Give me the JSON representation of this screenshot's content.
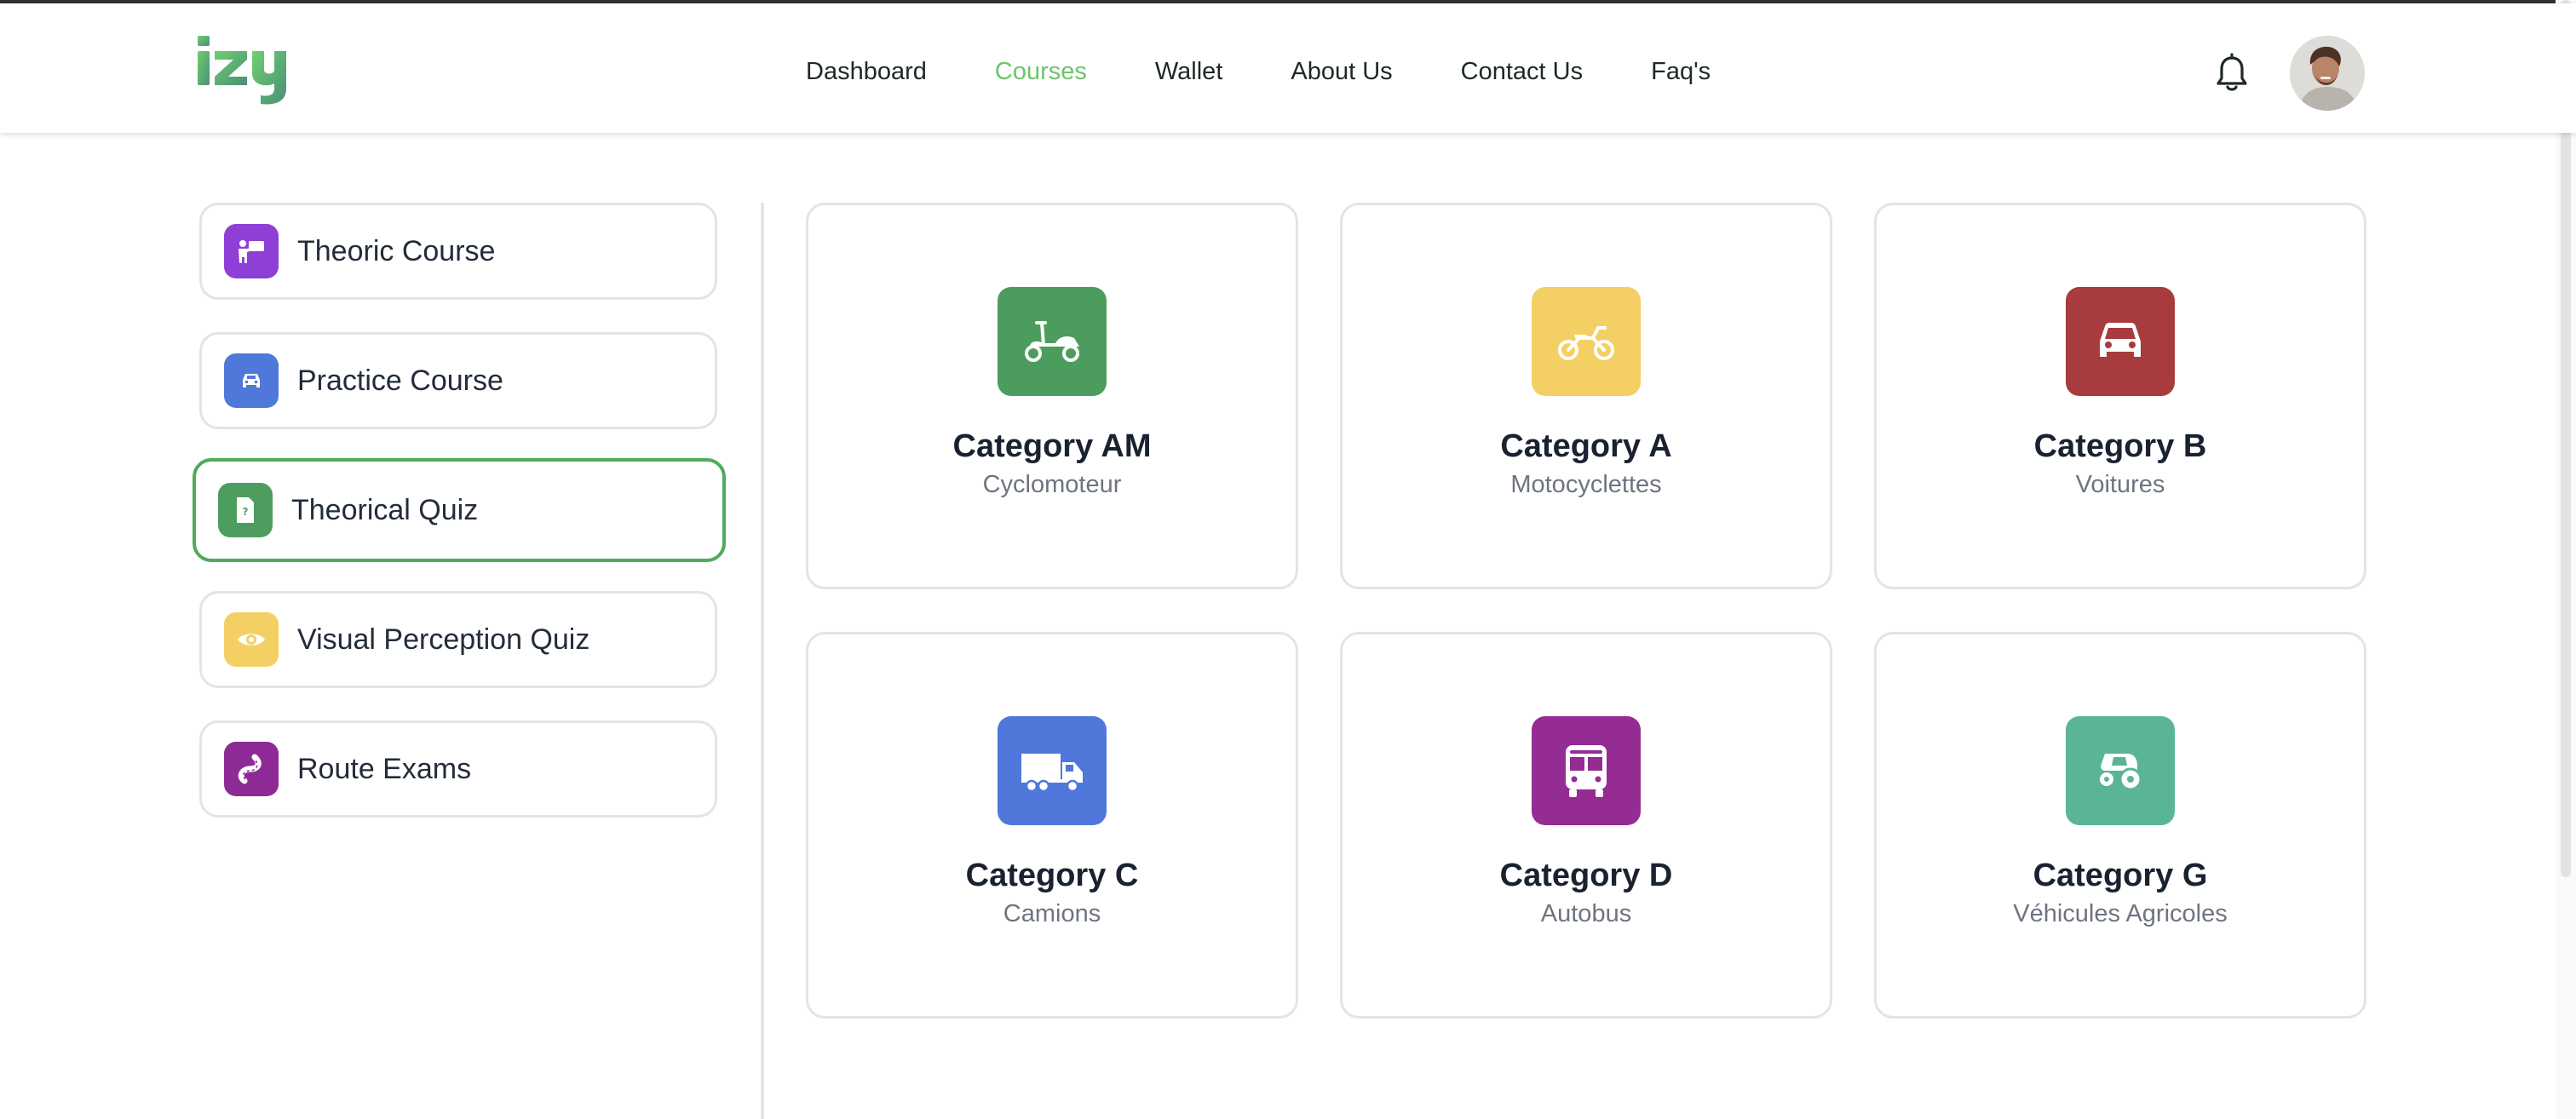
{
  "header": {
    "logo_text": "izy",
    "nav": [
      {
        "label": "Dashboard",
        "active": false
      },
      {
        "label": "Courses",
        "active": true
      },
      {
        "label": "Wallet",
        "active": false
      },
      {
        "label": "About Us",
        "active": false
      },
      {
        "label": "Contact Us",
        "active": false
      },
      {
        "label": "Faq's",
        "active": false
      }
    ],
    "icons": {
      "notifications": "bell-icon",
      "profile": "user-avatar"
    }
  },
  "sidebar": {
    "items": [
      {
        "label": "Theoric Course",
        "icon": "teacher-board-icon",
        "color": "#8e3fd6",
        "active": false
      },
      {
        "label": "Practice Course",
        "icon": "car-icon",
        "color": "#4f78da",
        "active": false
      },
      {
        "label": "Theorical Quiz",
        "icon": "quiz-document-icon",
        "color": "#4d9e5e",
        "active": true
      },
      {
        "label": "Visual Perception Quiz",
        "icon": "eye-icon",
        "color": "#f4d064",
        "active": false
      },
      {
        "label": "Route Exams",
        "icon": "road-icon",
        "color": "#8e2a95",
        "active": false
      }
    ]
  },
  "categories": [
    {
      "title": "Category AM",
      "subtitle": "Cyclomoteur",
      "icon": "scooter-icon",
      "color": "#4c9c5e"
    },
    {
      "title": "Category A",
      "subtitle": "Motocyclettes",
      "icon": "motorcycle-icon",
      "color": "#f4d064"
    },
    {
      "title": "Category B",
      "subtitle": "Voitures",
      "icon": "car-icon",
      "color": "#a83b3e"
    },
    {
      "title": "Category C",
      "subtitle": "Camions",
      "icon": "truck-icon",
      "color": "#4f78da"
    },
    {
      "title": "Category D",
      "subtitle": "Autobus",
      "icon": "bus-icon",
      "color": "#952c93"
    },
    {
      "title": "Category G",
      "subtitle": "Véhicules Agricoles",
      "icon": "tractor-icon",
      "color": "#5ab596"
    }
  ],
  "colors": {
    "brand_green": "#6cc46c",
    "active_border": "#4eab5a"
  }
}
